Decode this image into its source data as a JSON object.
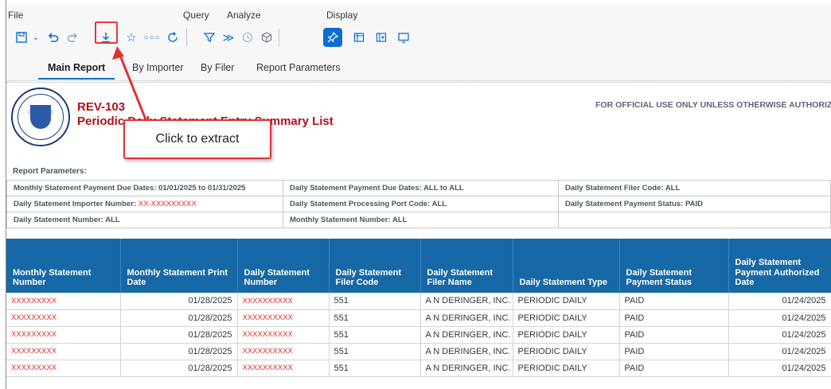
{
  "toolbar": {
    "groups": {
      "file": "File",
      "query": "Query",
      "analyze": "Analyze",
      "display": "Display"
    }
  },
  "tabs": [
    "Main Report",
    "By Importer",
    "By Filer",
    "Report Parameters"
  ],
  "report": {
    "seal_text": "DEPARTMENT OF HOMELAND SECURITY",
    "code": "REV-103",
    "title": "Periodic Daily Statement Entry Summary List",
    "official": "FOR OFFICIAL USE ONLY UNLESS OTHERWISE AUTHORIZED",
    "params_label": "Report Parameters:",
    "params": {
      "r1c1": "Monthly Statement Payment Due Dates: 01/01/2025 to 01/31/2025",
      "r1c2": "Daily Statement Payment Due Dates: ALL to ALL",
      "r1c3": "Daily Statement Filer Code: ALL",
      "r2c1_label": "Daily Statement Importer Number:",
      "r2c1_value": "XX-XXXXXXXXX",
      "r2c2": "Daily Statement Processing Port Code: ALL",
      "r2c3": "Daily Statement Payment Status: PAID",
      "r3c1": "Daily Statement Number: ALL",
      "r3c2": "Monthly Statement Number: ALL",
      "r3c3": ""
    }
  },
  "table": {
    "headers": {
      "h1": "Monthly Statement Number",
      "h2": "Monthly Statement Print Date",
      "h3": "Daily Statement Number",
      "h4": "Daily Statement Filer Code",
      "h5": "Daily Statement Filer Name",
      "h6": "Daily Statement Type",
      "h7": "Daily Statement Payment Status",
      "h8": "Daily Statement Payment Authorized Date"
    },
    "rows": [
      {
        "monthly_no": "XXXXXXXXX",
        "print_date": "01/28/2025",
        "daily_no": "XXXXXXXXXX",
        "filer_code": "551",
        "filer_name": "A N DERINGER, INC.",
        "type": "PERIODIC DAILY",
        "status": "PAID",
        "auth_date": "01/24/2025"
      },
      {
        "monthly_no": "XXXXXXXXX",
        "print_date": "01/28/2025",
        "daily_no": "XXXXXXXXXX",
        "filer_code": "551",
        "filer_name": "A N DERINGER, INC.",
        "type": "PERIODIC DAILY",
        "status": "PAID",
        "auth_date": "01/24/2025"
      },
      {
        "monthly_no": "XXXXXXXXX",
        "print_date": "01/28/2025",
        "daily_no": "XXXXXXXXXX",
        "filer_code": "551",
        "filer_name": "A N DERINGER, INC.",
        "type": "PERIODIC DAILY",
        "status": "PAID",
        "auth_date": "01/24/2025"
      },
      {
        "monthly_no": "XXXXXXXXX",
        "print_date": "01/28/2025",
        "daily_no": "XXXXXXXXXX",
        "filer_code": "551",
        "filer_name": "A N DERINGER, INC.",
        "type": "PERIODIC DAILY",
        "status": "PAID",
        "auth_date": "01/24/2025"
      },
      {
        "monthly_no": "XXXXXXXXX",
        "print_date": "01/28/2025",
        "daily_no": "XXXXXXXXXX",
        "filer_code": "551",
        "filer_name": "A N DERINGER, INC.",
        "type": "PERIODIC DAILY",
        "status": "PAID",
        "auth_date": "01/24/2025"
      }
    ]
  },
  "annotation": {
    "callout": "Click to extract"
  },
  "icons": [
    "save-icon",
    "undo-icon",
    "redo-icon",
    "export-icon",
    "favorite-icon",
    "more-icon",
    "refresh-icon",
    "filter-icon",
    "drill-icon",
    "history-icon",
    "cube-icon",
    "pin-icon",
    "columns-icon",
    "expand-icon",
    "presentation-icon"
  ],
  "colors": {
    "accent": "#0a6ed1",
    "header_blue": "#1768a6",
    "report_red": "#b3101b",
    "annotation_red": "#e03131"
  }
}
